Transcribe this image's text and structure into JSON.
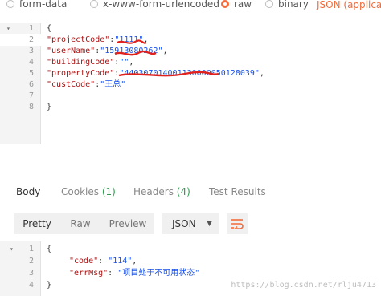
{
  "body_types": {
    "form_data": "form-data",
    "urlencoded": "x-www-form-urlencoded",
    "raw": "raw",
    "binary": "binary",
    "format_select": "JSON (applicat"
  },
  "request_editor": {
    "lines": [
      {
        "num": "1",
        "fold": "▾",
        "text": "{"
      },
      {
        "num": "2",
        "key": "\"projectCode\"",
        "sep": ":",
        "value": "\"1111\"",
        "tail": ","
      },
      {
        "num": "3",
        "key": "\"userName\"",
        "sep": ":",
        "value": "\"15913080262\"",
        "tail": ","
      },
      {
        "num": "4",
        "key": "\"buildingCode\"",
        "sep": ":",
        "value": "\"\"",
        "tail": ","
      },
      {
        "num": "5",
        "key": "\"propertyCode\"",
        "sep": ":",
        "value": "\"440307014001130000050128039\"",
        "tail": ","
      },
      {
        "num": "6",
        "key": "\"custCode\"",
        "sep": ":",
        "value": "\"王总\"",
        "tail": ""
      },
      {
        "num": "7",
        "text": ""
      },
      {
        "num": "8",
        "text": "}"
      }
    ]
  },
  "response_tabs": {
    "body": "Body",
    "cookies": "Cookies",
    "cookies_count": "(1)",
    "headers": "Headers",
    "headers_count": "(4)",
    "tests": "Test Results"
  },
  "response_toolbar": {
    "pretty": "Pretty",
    "raw": "Raw",
    "preview": "Preview",
    "format": "JSON",
    "wrap_icon": "wrap-lines-icon"
  },
  "response_editor": {
    "lines": [
      {
        "num": "1",
        "fold": "▾",
        "text": "{"
      },
      {
        "num": "2",
        "key": "\"code\"",
        "sep": ": ",
        "value": "\"114\"",
        "tail": ","
      },
      {
        "num": "3",
        "key": "\"errMsg\"",
        "sep": ": ",
        "value": "\"项目处于不可用状态\"",
        "tail": ""
      },
      {
        "num": "4",
        "text": "}"
      }
    ],
    "watermark": "https://blog.csdn.net/rlju4713"
  },
  "colors": {
    "accent": "#f26b3a",
    "count_green": "#2e9e4f",
    "redaction": "#e0211c"
  }
}
